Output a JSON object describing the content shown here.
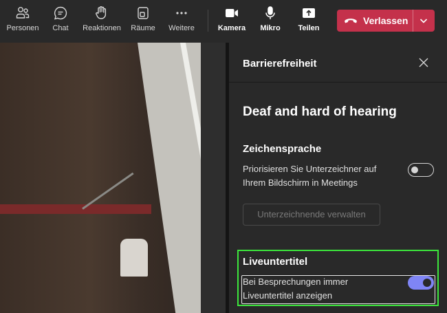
{
  "toolbar": {
    "items": [
      {
        "label": "Personen",
        "icon": "people-icon"
      },
      {
        "label": "Chat",
        "icon": "chat-icon"
      },
      {
        "label": "Reaktionen",
        "icon": "raise-hand-icon"
      },
      {
        "label": "Räume",
        "icon": "rooms-icon"
      },
      {
        "label": "Weitere",
        "icon": "more-icon"
      },
      {
        "label": "Kamera",
        "icon": "camera-icon"
      },
      {
        "label": "Mikro",
        "icon": "microphone-icon"
      },
      {
        "label": "Teilen",
        "icon": "share-icon"
      }
    ],
    "leave": {
      "label": "Verlassen",
      "icon": "hangup-icon",
      "accent": "#c4314b"
    }
  },
  "panel": {
    "title": "Barrierefreiheit",
    "section_heading": "Deaf and hard of hearing",
    "sign_language": {
      "heading": "Zeichensprache",
      "description": "Priorisieren Sie Unterzeichner auf Ihrem Bildschirm in Meetings",
      "toggle_on": false,
      "manage_button": "Unterzeichnende verwalten"
    },
    "captions": {
      "heading": "Liveuntertitel",
      "description": "Bei Besprechungen immer Liveuntertitel anzeigen",
      "toggle_on": true,
      "toggle_color": "#7f85f5"
    }
  },
  "colors": {
    "highlight": "#3ce63c",
    "toolbar_bg": "#292929",
    "panel_bg": "#292929"
  }
}
